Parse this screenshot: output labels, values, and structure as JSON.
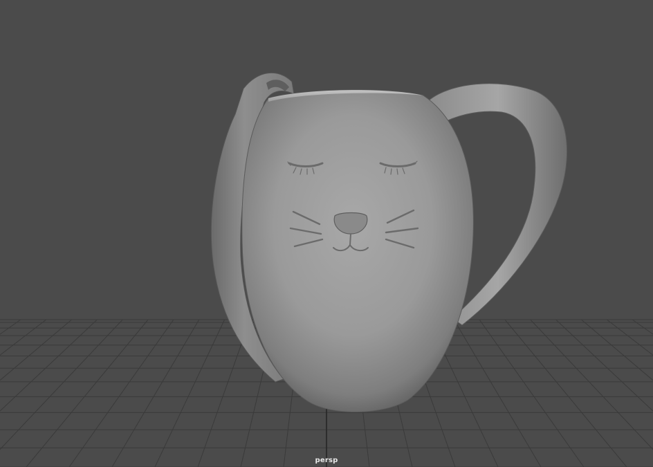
{
  "viewport": {
    "camera_label": "persp",
    "background_color": "#4b4b4b",
    "grid_color": "#3a3a3a",
    "grid_axis_color": "#262626",
    "object": {
      "name": "cat-face-mug",
      "material_color": "#9a9a9a"
    }
  }
}
